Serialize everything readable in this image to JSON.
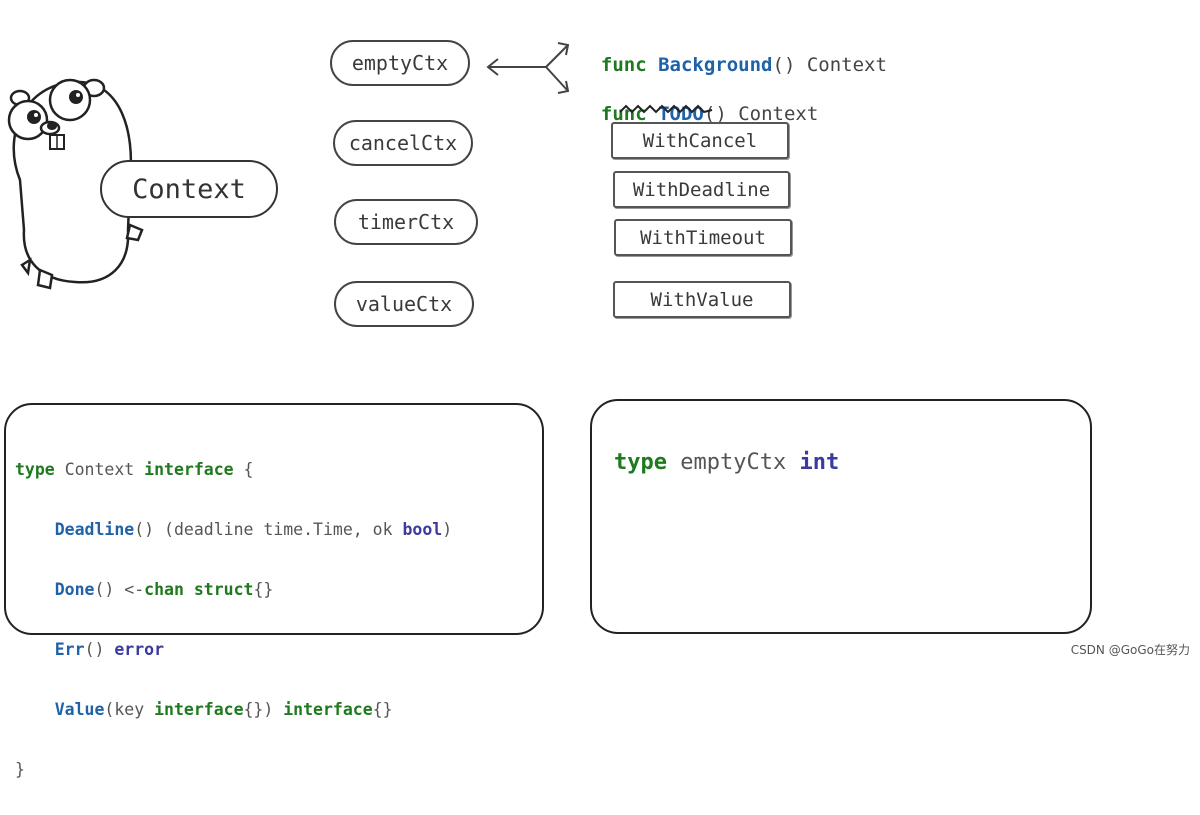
{
  "concept_label": "Context",
  "impl_types": [
    "emptyCtx",
    "cancelCtx",
    "timerCtx",
    "valueCtx"
  ],
  "funcs": {
    "background": {
      "keyword": "func",
      "name": "Background",
      "params": "()",
      "ret": "Context"
    },
    "todo": {
      "keyword": "func",
      "name": "TODO",
      "params": "()",
      "ret": "Context"
    }
  },
  "constructors": [
    "WithCancel",
    "WithDeadline",
    "WithTimeout",
    "WithValue"
  ],
  "interface_code": {
    "l1_kw": "type",
    "l1_name": "Context",
    "l1_kw2": "interface",
    "l1_brace": "{",
    "deadline_fn": "Deadline",
    "deadline_rest": "() (deadline time.Time, ok ",
    "deadline_bool": "bool",
    "deadline_close": ")",
    "done_fn": "Done",
    "done_rest": "() <-",
    "done_chan": "chan",
    "done_struct": "struct",
    "done_braces": "{}",
    "err_fn": "Err",
    "err_rest": "() ",
    "err_type": "error",
    "value_fn": "Value",
    "value_rest1": "(key ",
    "value_iface1": "interface",
    "value_rest2": "{}) ",
    "value_iface2": "interface",
    "value_rest3": "{}",
    "close_brace": "}"
  },
  "empty_code": {
    "kw": "type",
    "name": "emptyCtx",
    "type": "int"
  },
  "footer": "CSDN @GoGo在努力",
  "colors": {
    "keyword": "#1f7a1f",
    "func_name": "#1f62a8",
    "builtin": "#3a3aa0"
  }
}
